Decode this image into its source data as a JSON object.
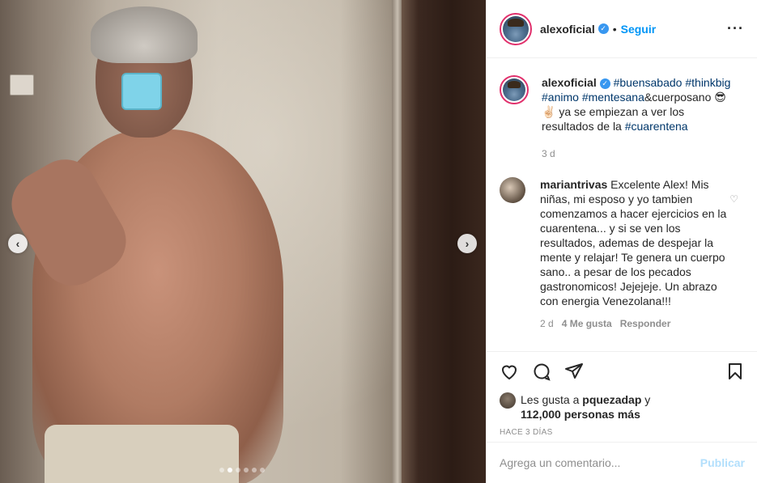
{
  "post": {
    "carousel": {
      "dot_count": 6,
      "active_index": 1
    },
    "author": {
      "username": "alexoficial",
      "verified": true,
      "separator": "•",
      "follow_label": "Seguir",
      "more_label": "···"
    },
    "caption": {
      "username": "alexoficial",
      "parts": [
        "#buensabado",
        "#thinkbig",
        "#animo",
        "#mentesana",
        "&cuerposano 😎 ✌🏻 ya se empiezan a ver los resultados de la ",
        "#cuarentena"
      ],
      "age": "3 d"
    },
    "comment": {
      "username": "mariantrivas",
      "text": "Excelente Alex! Mis niñas, mi esposo y yo tambien comenzamos a hacer ejercicios en la cuarentena... y si se ven los resultados, ademas de despejar la mente y relajar! Te genera un cuerpo sano.. a pesar de los pecados gastronomicos! Jejejeje. Un abrazo con energia Venezolana!!!",
      "age": "2 d",
      "likes": "4 Me gusta",
      "reply_label": "Responder"
    },
    "likes": {
      "prefix": "Les gusta a ",
      "user": "pquezadap",
      "connector": " y",
      "count_text": "112,000 personas más"
    },
    "timestamp": "HACE 3 DÍAS",
    "add_comment": {
      "placeholder": "Agrega un comentario...",
      "publish_label": "Publicar"
    },
    "icons": [
      "heart-icon",
      "comment-icon",
      "share-icon",
      "bookmark-icon"
    ],
    "colors": {
      "link": "#00376b",
      "follow": "#0095f6",
      "publish_disabled": "#b2dffc",
      "verified": "#3897f0"
    }
  }
}
